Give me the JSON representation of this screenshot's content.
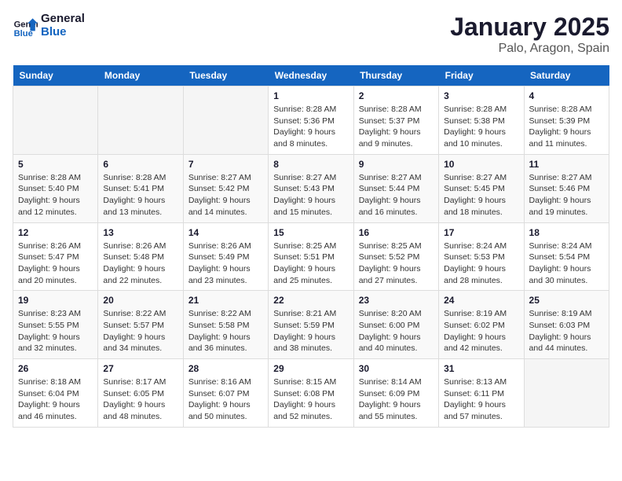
{
  "header": {
    "logo_line1": "General",
    "logo_line2": "Blue",
    "month": "January 2025",
    "location": "Palo, Aragon, Spain"
  },
  "weekdays": [
    "Sunday",
    "Monday",
    "Tuesday",
    "Wednesday",
    "Thursday",
    "Friday",
    "Saturday"
  ],
  "weeks": [
    [
      {
        "day": "",
        "sunrise": "",
        "sunset": "",
        "daylight": ""
      },
      {
        "day": "",
        "sunrise": "",
        "sunset": "",
        "daylight": ""
      },
      {
        "day": "",
        "sunrise": "",
        "sunset": "",
        "daylight": ""
      },
      {
        "day": "1",
        "sunrise": "Sunrise: 8:28 AM",
        "sunset": "Sunset: 5:36 PM",
        "daylight": "Daylight: 9 hours and 8 minutes."
      },
      {
        "day": "2",
        "sunrise": "Sunrise: 8:28 AM",
        "sunset": "Sunset: 5:37 PM",
        "daylight": "Daylight: 9 hours and 9 minutes."
      },
      {
        "day": "3",
        "sunrise": "Sunrise: 8:28 AM",
        "sunset": "Sunset: 5:38 PM",
        "daylight": "Daylight: 9 hours and 10 minutes."
      },
      {
        "day": "4",
        "sunrise": "Sunrise: 8:28 AM",
        "sunset": "Sunset: 5:39 PM",
        "daylight": "Daylight: 9 hours and 11 minutes."
      }
    ],
    [
      {
        "day": "5",
        "sunrise": "Sunrise: 8:28 AM",
        "sunset": "Sunset: 5:40 PM",
        "daylight": "Daylight: 9 hours and 12 minutes."
      },
      {
        "day": "6",
        "sunrise": "Sunrise: 8:28 AM",
        "sunset": "Sunset: 5:41 PM",
        "daylight": "Daylight: 9 hours and 13 minutes."
      },
      {
        "day": "7",
        "sunrise": "Sunrise: 8:27 AM",
        "sunset": "Sunset: 5:42 PM",
        "daylight": "Daylight: 9 hours and 14 minutes."
      },
      {
        "day": "8",
        "sunrise": "Sunrise: 8:27 AM",
        "sunset": "Sunset: 5:43 PM",
        "daylight": "Daylight: 9 hours and 15 minutes."
      },
      {
        "day": "9",
        "sunrise": "Sunrise: 8:27 AM",
        "sunset": "Sunset: 5:44 PM",
        "daylight": "Daylight: 9 hours and 16 minutes."
      },
      {
        "day": "10",
        "sunrise": "Sunrise: 8:27 AM",
        "sunset": "Sunset: 5:45 PM",
        "daylight": "Daylight: 9 hours and 18 minutes."
      },
      {
        "day": "11",
        "sunrise": "Sunrise: 8:27 AM",
        "sunset": "Sunset: 5:46 PM",
        "daylight": "Daylight: 9 hours and 19 minutes."
      }
    ],
    [
      {
        "day": "12",
        "sunrise": "Sunrise: 8:26 AM",
        "sunset": "Sunset: 5:47 PM",
        "daylight": "Daylight: 9 hours and 20 minutes."
      },
      {
        "day": "13",
        "sunrise": "Sunrise: 8:26 AM",
        "sunset": "Sunset: 5:48 PM",
        "daylight": "Daylight: 9 hours and 22 minutes."
      },
      {
        "day": "14",
        "sunrise": "Sunrise: 8:26 AM",
        "sunset": "Sunset: 5:49 PM",
        "daylight": "Daylight: 9 hours and 23 minutes."
      },
      {
        "day": "15",
        "sunrise": "Sunrise: 8:25 AM",
        "sunset": "Sunset: 5:51 PM",
        "daylight": "Daylight: 9 hours and 25 minutes."
      },
      {
        "day": "16",
        "sunrise": "Sunrise: 8:25 AM",
        "sunset": "Sunset: 5:52 PM",
        "daylight": "Daylight: 9 hours and 27 minutes."
      },
      {
        "day": "17",
        "sunrise": "Sunrise: 8:24 AM",
        "sunset": "Sunset: 5:53 PM",
        "daylight": "Daylight: 9 hours and 28 minutes."
      },
      {
        "day": "18",
        "sunrise": "Sunrise: 8:24 AM",
        "sunset": "Sunset: 5:54 PM",
        "daylight": "Daylight: 9 hours and 30 minutes."
      }
    ],
    [
      {
        "day": "19",
        "sunrise": "Sunrise: 8:23 AM",
        "sunset": "Sunset: 5:55 PM",
        "daylight": "Daylight: 9 hours and 32 minutes."
      },
      {
        "day": "20",
        "sunrise": "Sunrise: 8:22 AM",
        "sunset": "Sunset: 5:57 PM",
        "daylight": "Daylight: 9 hours and 34 minutes."
      },
      {
        "day": "21",
        "sunrise": "Sunrise: 8:22 AM",
        "sunset": "Sunset: 5:58 PM",
        "daylight": "Daylight: 9 hours and 36 minutes."
      },
      {
        "day": "22",
        "sunrise": "Sunrise: 8:21 AM",
        "sunset": "Sunset: 5:59 PM",
        "daylight": "Daylight: 9 hours and 38 minutes."
      },
      {
        "day": "23",
        "sunrise": "Sunrise: 8:20 AM",
        "sunset": "Sunset: 6:00 PM",
        "daylight": "Daylight: 9 hours and 40 minutes."
      },
      {
        "day": "24",
        "sunrise": "Sunrise: 8:19 AM",
        "sunset": "Sunset: 6:02 PM",
        "daylight": "Daylight: 9 hours and 42 minutes."
      },
      {
        "day": "25",
        "sunrise": "Sunrise: 8:19 AM",
        "sunset": "Sunset: 6:03 PM",
        "daylight": "Daylight: 9 hours and 44 minutes."
      }
    ],
    [
      {
        "day": "26",
        "sunrise": "Sunrise: 8:18 AM",
        "sunset": "Sunset: 6:04 PM",
        "daylight": "Daylight: 9 hours and 46 minutes."
      },
      {
        "day": "27",
        "sunrise": "Sunrise: 8:17 AM",
        "sunset": "Sunset: 6:05 PM",
        "daylight": "Daylight: 9 hours and 48 minutes."
      },
      {
        "day": "28",
        "sunrise": "Sunrise: 8:16 AM",
        "sunset": "Sunset: 6:07 PM",
        "daylight": "Daylight: 9 hours and 50 minutes."
      },
      {
        "day": "29",
        "sunrise": "Sunrise: 8:15 AM",
        "sunset": "Sunset: 6:08 PM",
        "daylight": "Daylight: 9 hours and 52 minutes."
      },
      {
        "day": "30",
        "sunrise": "Sunrise: 8:14 AM",
        "sunset": "Sunset: 6:09 PM",
        "daylight": "Daylight: 9 hours and 55 minutes."
      },
      {
        "day": "31",
        "sunrise": "Sunrise: 8:13 AM",
        "sunset": "Sunset: 6:11 PM",
        "daylight": "Daylight: 9 hours and 57 minutes."
      },
      {
        "day": "",
        "sunrise": "",
        "sunset": "",
        "daylight": ""
      }
    ]
  ]
}
